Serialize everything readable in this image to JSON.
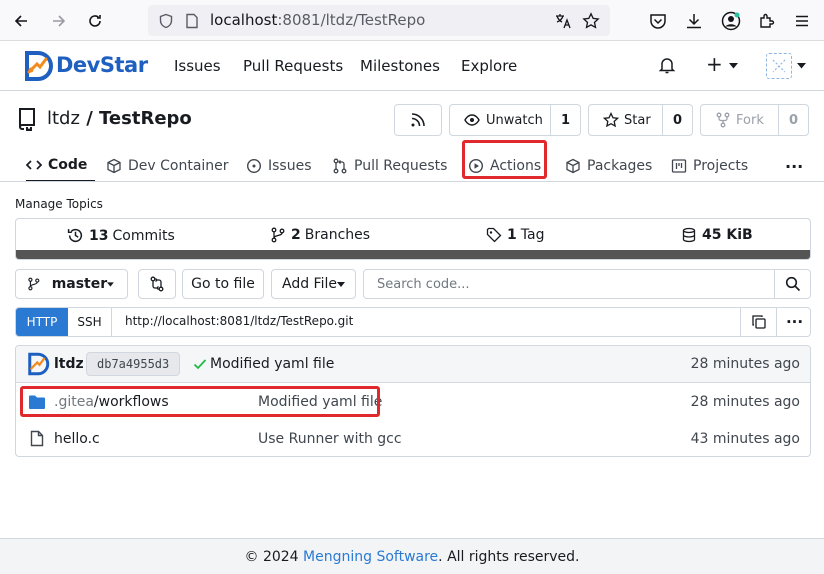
{
  "browser": {
    "url_host": "localhost",
    "url_rest": ":8081/ltdz/TestRepo"
  },
  "nav": {
    "brand": "DevStar",
    "links": [
      "Issues",
      "Pull Requests",
      "Milestones",
      "Explore"
    ],
    "plus": "+"
  },
  "repo": {
    "owner": "ltdz",
    "separator": " / ",
    "name": "TestRepo",
    "unwatch_label": "Unwatch",
    "watch_count": "1",
    "star_label": "Star",
    "star_count": "0",
    "fork_label": "Fork",
    "fork_count": "0"
  },
  "tabs": [
    {
      "label": "Code",
      "icon": "code-icon",
      "active": true
    },
    {
      "label": "Dev Container",
      "icon": "package-icon"
    },
    {
      "label": "Issues",
      "icon": "issue-opened-icon"
    },
    {
      "label": "Pull Requests",
      "icon": "git-pull-request-icon"
    },
    {
      "label": "Actions",
      "icon": "play-icon",
      "highlighted": true
    },
    {
      "label": "Packages",
      "icon": "package-icon"
    },
    {
      "label": "Projects",
      "icon": "project-icon"
    }
  ],
  "more": "···",
  "manage_topics": "Manage Topics",
  "stats": {
    "commits_count": "13",
    "commits_label": "Commits",
    "branches_count": "2",
    "branches_label": "Branches",
    "tags_count": "1",
    "tags_label": "Tag",
    "size_value": "45 KiB"
  },
  "toolbar": {
    "branch": "master",
    "go_to_file": "Go to file",
    "add_file": "Add File",
    "search_placeholder": "Search code..."
  },
  "clone": {
    "http_label": "HTTP",
    "ssh_label": "SSH",
    "url": "http://localhost:8081/ltdz/TestRepo.git"
  },
  "latest_commit": {
    "author": "ltdz",
    "sha": "db7a4955d3",
    "message": "Modified yaml file",
    "time": "28 minutes ago"
  },
  "files": [
    {
      "name_prefix": ".gitea",
      "name_rest": "/workflows",
      "type": "folder",
      "message": "Modified yaml file",
      "time": "28 minutes ago",
      "highlighted": true
    },
    {
      "name_prefix": "hello.c",
      "name_rest": "",
      "type": "file",
      "message": "Use Runner with gcc",
      "time": "43 minutes ago"
    }
  ],
  "footer": {
    "prefix": "© 2024 ",
    "link": "Mengning Software",
    "suffix": ". All rights reserved."
  },
  "colors": {
    "accent": "#2a7ad3",
    "highlight_border": "#e0292d",
    "success": "#21ba45"
  }
}
